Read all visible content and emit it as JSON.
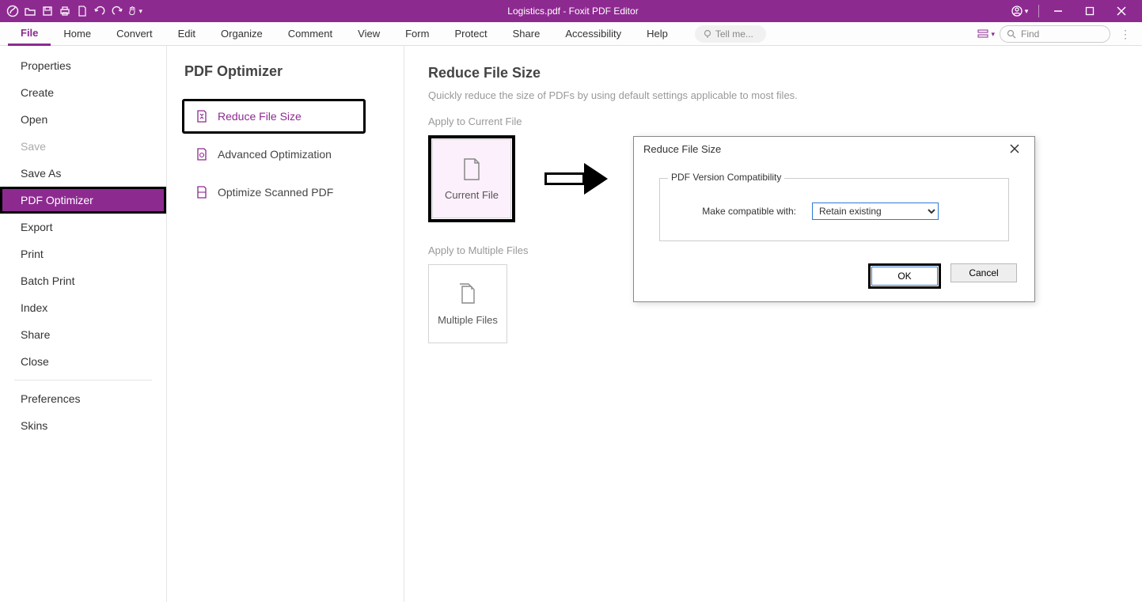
{
  "titlebar": {
    "title": "Logistics.pdf - Foxit PDF Editor"
  },
  "ribbon": {
    "tabs": [
      "File",
      "Home",
      "Convert",
      "Edit",
      "Organize",
      "Comment",
      "View",
      "Form",
      "Protect",
      "Share",
      "Accessibility",
      "Help"
    ],
    "active": "File",
    "tellme_placeholder": "Tell me...",
    "find_placeholder": "Find"
  },
  "sidebar1": {
    "items": [
      "Properties",
      "Create",
      "Open",
      "Save",
      "Save As",
      "PDF Optimizer",
      "Export",
      "Print",
      "Batch Print",
      "Index",
      "Share",
      "Close"
    ],
    "items2": [
      "Preferences",
      "Skins"
    ],
    "disabled": "Save",
    "selected": "PDF Optimizer"
  },
  "sidebar2": {
    "title": "PDF Optimizer",
    "options": [
      {
        "label": "Reduce File Size",
        "selected": true,
        "highlight": true
      },
      {
        "label": "Advanced Optimization",
        "selected": false,
        "highlight": false
      },
      {
        "label": "Optimize Scanned PDF",
        "selected": false,
        "highlight": false
      }
    ]
  },
  "content": {
    "title": "Reduce File Size",
    "desc": "Quickly reduce the size of PDFs by using default settings applicable to most files.",
    "sec1": "Apply to Current File",
    "tile1": "Current File",
    "sec2": "Apply to Multiple Files",
    "tile2": "Multiple Files"
  },
  "dialog": {
    "title": "Reduce File Size",
    "legend": "PDF Version Compatibility",
    "label": "Make compatible with:",
    "value": "Retain existing",
    "ok": "OK",
    "cancel": "Cancel"
  }
}
